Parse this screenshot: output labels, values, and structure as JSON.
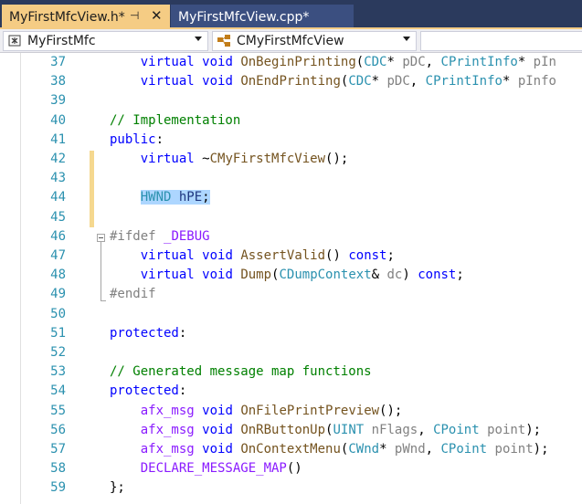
{
  "tabs": [
    {
      "label": "MyFirstMfcView.h*",
      "active": true
    },
    {
      "label": "MyFirstMfcView.cpp*",
      "active": false
    }
  ],
  "tab_icons": {
    "pin": "pin-icon",
    "close": "close-icon"
  },
  "nav": {
    "project_combo": "MyFirstMfc",
    "class_combo": "CMyFirstMfcView",
    "member_combo": ""
  },
  "colors": {
    "active_tab": "#f5cc84",
    "keyword": "#0000ff",
    "type": "#2b91af",
    "comment": "#008000",
    "macro": "#8a1bff",
    "selection": "#add6ff",
    "change_bar": "#f5d88f"
  },
  "lines": [
    {
      "n": "37",
      "tokens": [
        [
          "    ",
          ""
        ],
        [
          "virtual",
          "kw"
        ],
        [
          " ",
          ""
        ],
        [
          "void",
          "kw"
        ],
        [
          " ",
          ""
        ],
        [
          "OnBeginPrinting",
          "fn"
        ],
        [
          "(",
          ""
        ],
        [
          "CDC",
          "ty"
        ],
        [
          "* ",
          ""
        ],
        [
          "pDC",
          "prm"
        ],
        [
          ", ",
          ""
        ],
        [
          "CPrintInfo",
          "ty"
        ],
        [
          "* ",
          ""
        ],
        [
          "pIn",
          "prm"
        ]
      ]
    },
    {
      "n": "38",
      "tokens": [
        [
          "    ",
          ""
        ],
        [
          "virtual",
          "kw"
        ],
        [
          " ",
          ""
        ],
        [
          "void",
          "kw"
        ],
        [
          " ",
          ""
        ],
        [
          "OnEndPrinting",
          "fn"
        ],
        [
          "(",
          ""
        ],
        [
          "CDC",
          "ty"
        ],
        [
          "* ",
          ""
        ],
        [
          "pDC",
          "prm"
        ],
        [
          ", ",
          ""
        ],
        [
          "CPrintInfo",
          "ty"
        ],
        [
          "* ",
          ""
        ],
        [
          "pInfo",
          "prm"
        ]
      ]
    },
    {
      "n": "39",
      "tokens": []
    },
    {
      "n": "40",
      "tokens": [
        [
          "// Implementation",
          "cm"
        ]
      ]
    },
    {
      "n": "41",
      "tokens": [
        [
          "public",
          "kw"
        ],
        [
          ":",
          ""
        ]
      ]
    },
    {
      "n": "42",
      "tokens": [
        [
          "    ",
          ""
        ],
        [
          "virtual",
          "kw"
        ],
        [
          " ~",
          ""
        ],
        [
          "CMyFirstMfcView",
          "fn"
        ],
        [
          "();",
          ""
        ]
      ]
    },
    {
      "n": "43",
      "tokens": []
    },
    {
      "n": "44",
      "tokens": [
        [
          "    ",
          ""
        ],
        [
          "HWND",
          "ty hl"
        ],
        [
          " ",
          "hl"
        ],
        [
          "hPE",
          "var hl"
        ],
        [
          ";",
          "hl"
        ]
      ]
    },
    {
      "n": "45",
      "tokens": []
    },
    {
      "n": "46",
      "tokens": [
        [
          "#ifdef",
          "pp"
        ],
        [
          " ",
          ""
        ],
        [
          "_DEBUG",
          "mac"
        ]
      ]
    },
    {
      "n": "47",
      "tokens": [
        [
          "    ",
          ""
        ],
        [
          "virtual",
          "kw"
        ],
        [
          " ",
          ""
        ],
        [
          "void",
          "kw"
        ],
        [
          " ",
          ""
        ],
        [
          "AssertValid",
          "fn"
        ],
        [
          "() ",
          ""
        ],
        [
          "const",
          "kw"
        ],
        [
          ";",
          ""
        ]
      ]
    },
    {
      "n": "48",
      "tokens": [
        [
          "    ",
          ""
        ],
        [
          "virtual",
          "kw"
        ],
        [
          " ",
          ""
        ],
        [
          "void",
          "kw"
        ],
        [
          " ",
          ""
        ],
        [
          "Dump",
          "fn"
        ],
        [
          "(",
          ""
        ],
        [
          "CDumpContext",
          "ty"
        ],
        [
          "& ",
          ""
        ],
        [
          "dc",
          "prm"
        ],
        [
          ") ",
          ""
        ],
        [
          "const",
          "kw"
        ],
        [
          ";",
          ""
        ]
      ]
    },
    {
      "n": "49",
      "tokens": [
        [
          "#endif",
          "pp"
        ]
      ]
    },
    {
      "n": "50",
      "tokens": []
    },
    {
      "n": "51",
      "tokens": [
        [
          "protected",
          "kw"
        ],
        [
          ":",
          ""
        ]
      ]
    },
    {
      "n": "52",
      "tokens": []
    },
    {
      "n": "53",
      "tokens": [
        [
          "// Generated message map functions",
          "cm"
        ]
      ]
    },
    {
      "n": "54",
      "tokens": [
        [
          "protected",
          "kw"
        ],
        [
          ":",
          ""
        ]
      ]
    },
    {
      "n": "55",
      "tokens": [
        [
          "    ",
          ""
        ],
        [
          "afx_msg",
          "mac"
        ],
        [
          " ",
          ""
        ],
        [
          "void",
          "kw"
        ],
        [
          " ",
          ""
        ],
        [
          "OnFilePrintPreview",
          "fn"
        ],
        [
          "();",
          ""
        ]
      ]
    },
    {
      "n": "56",
      "tokens": [
        [
          "    ",
          ""
        ],
        [
          "afx_msg",
          "mac"
        ],
        [
          " ",
          ""
        ],
        [
          "void",
          "kw"
        ],
        [
          " ",
          ""
        ],
        [
          "OnRButtonUp",
          "fn"
        ],
        [
          "(",
          ""
        ],
        [
          "UINT",
          "ty"
        ],
        [
          " ",
          ""
        ],
        [
          "nFlags",
          "prm"
        ],
        [
          ", ",
          ""
        ],
        [
          "CPoint",
          "ty"
        ],
        [
          " ",
          ""
        ],
        [
          "point",
          "prm"
        ],
        [
          ");",
          ""
        ]
      ]
    },
    {
      "n": "57",
      "tokens": [
        [
          "    ",
          ""
        ],
        [
          "afx_msg",
          "mac"
        ],
        [
          " ",
          ""
        ],
        [
          "void",
          "kw"
        ],
        [
          " ",
          ""
        ],
        [
          "OnContextMenu",
          "fn"
        ],
        [
          "(",
          ""
        ],
        [
          "CWnd",
          "ty"
        ],
        [
          "* ",
          ""
        ],
        [
          "pWnd",
          "prm"
        ],
        [
          ", ",
          ""
        ],
        [
          "CPoint",
          "ty"
        ],
        [
          " ",
          ""
        ],
        [
          "point",
          "prm"
        ],
        [
          ");",
          ""
        ]
      ]
    },
    {
      "n": "58",
      "tokens": [
        [
          "    ",
          ""
        ],
        [
          "DECLARE_MESSAGE_MAP",
          "mac"
        ],
        [
          "()",
          ""
        ]
      ]
    },
    {
      "n": "59",
      "tokens": [
        [
          "};",
          ""
        ]
      ]
    }
  ]
}
